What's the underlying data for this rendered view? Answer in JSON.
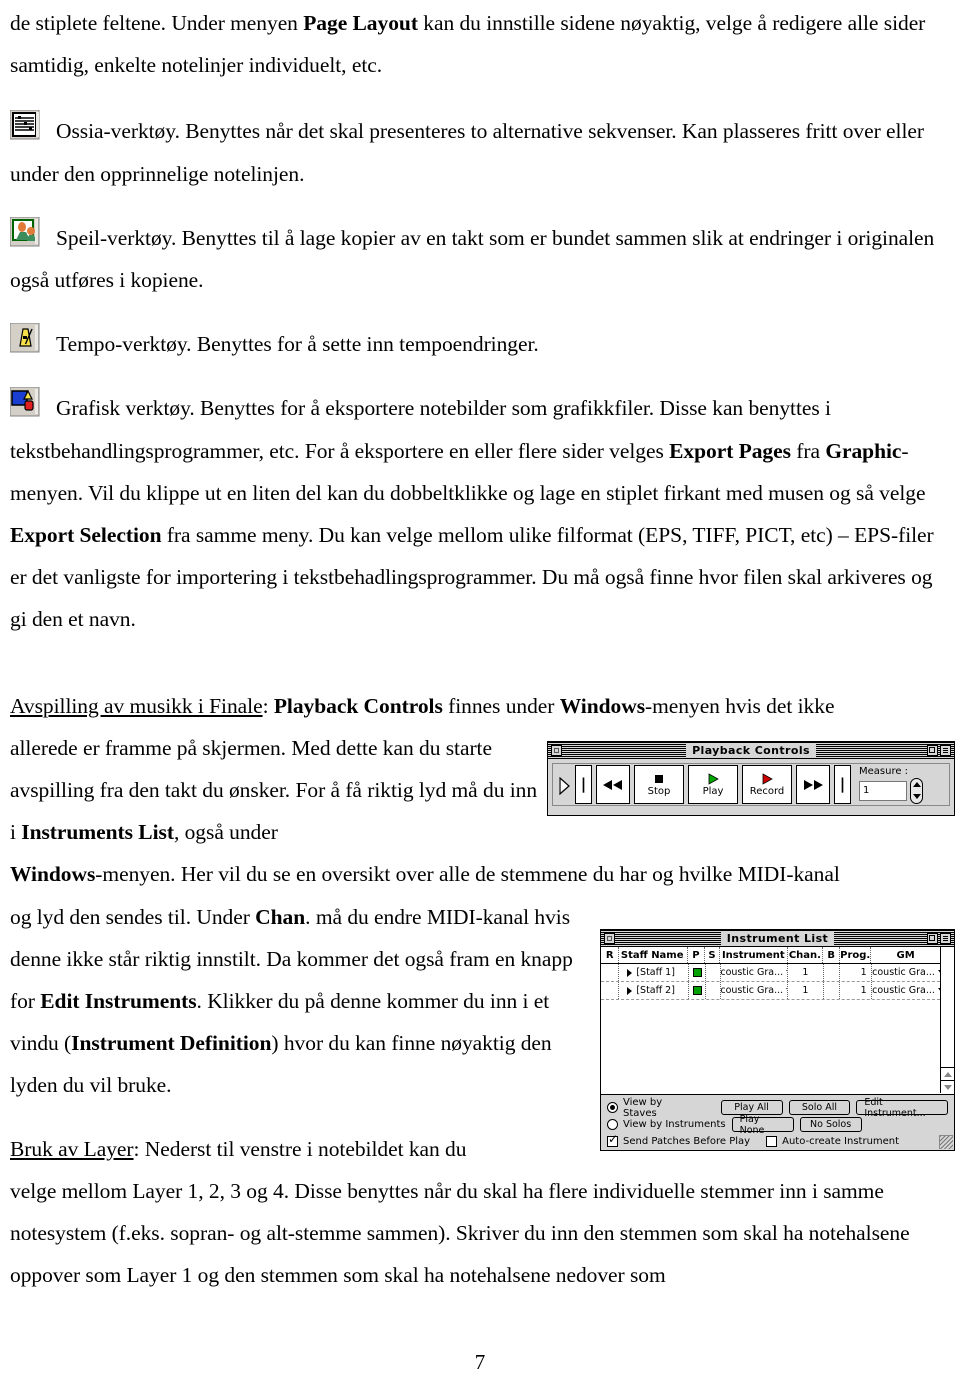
{
  "document": {
    "page_number": "7",
    "paragraphs": [
      {
        "id": "p1",
        "runs": [
          {
            "t": "de stiplete feltene. Under menyen ",
            "b": false
          },
          {
            "t": "Page Layout",
            "b": true
          },
          {
            "t": " kan du innstille sidene nøyaktig, velge å redigere alle sider samtidig, enkelte notelinjer individuelt, etc.",
            "b": false
          }
        ]
      },
      {
        "id": "p2",
        "icon": "ossia-tool-icon",
        "runs": [
          {
            "t": "Ossia-verktøy. Benyttes når det skal presenteres to alternative sekvenser. Kan plasseres fritt over eller under den opprinnelige notelinjen.",
            "b": false
          }
        ]
      },
      {
        "id": "p3",
        "icon": "mirror-tool-icon",
        "runs": [
          {
            "t": "Speil-verktøy. Benyttes til å lage kopier av en takt som er bundet sammen slik at endringer i originalen også utføres i kopiene.",
            "b": false
          }
        ]
      },
      {
        "id": "p4",
        "icon": "tempo-tool-icon",
        "runs": [
          {
            "t": "Tempo-verktøy. Benyttes for å sette inn tempoendringer.",
            "b": false
          }
        ]
      },
      {
        "id": "p5",
        "icon": "graphics-tool-icon",
        "runs": [
          {
            "t": "Grafisk verktøy. Benyttes for å eksportere notebilder som grafikkfiler. Disse kan benyttes i tekstbehandlingsprogrammer, etc. For å eksportere en eller flere sider velges ",
            "b": false
          },
          {
            "t": "Export Pages",
            "b": true
          },
          {
            "t": " fra ",
            "b": false
          },
          {
            "t": "Graphic",
            "b": true
          },
          {
            "t": "-menyen. Vil du klippe ut en liten del kan du dobbeltklikke og lage en stiplet firkant med musen og så velge ",
            "b": false
          },
          {
            "t": "Export Selection",
            "b": true
          },
          {
            "t": " fra samme meny. Du kan velge mellom ulike filformat (EPS, TIFF, PICT, etc) – EPS-filer er det vanligste for importering i tekstbehadlingsprogrammer. Du må også finne hvor filen skal arkiveres og gi den et navn.",
            "b": false
          }
        ]
      },
      {
        "id": "p6",
        "runs": [
          {
            "t": "Avspilling av musikk i Finale",
            "b": false,
            "u": true
          },
          {
            "t": ": ",
            "b": false
          },
          {
            "t": "Playback Controls",
            "b": true
          },
          {
            "t": " finnes under ",
            "b": false
          },
          {
            "t": "Windows",
            "b": true
          },
          {
            "t": "-menyen hvis det ikke allerede er framme på skjermen. Med dette kan du starte avspilling fra den takt du ønsker. For å få riktig lyd må du inn i ",
            "b": false
          },
          {
            "t": "Instruments List",
            "b": true
          },
          {
            "t": ", også under ",
            "b": false
          }
        ]
      },
      {
        "id": "p7",
        "runs": [
          {
            "t": "Windows",
            "b": true
          },
          {
            "t": "-menyen. Her vil du se en oversikt over alle de stemmene du har og hvilke MIDI-kanal og lyd den sendes til. Under ",
            "b": false
          },
          {
            "t": "Chan",
            "b": true
          },
          {
            "t": ". må du endre MIDI-kanal hvis denne ikke står riktig innstilt. Da kommer det også fram en knapp for ",
            "b": false
          },
          {
            "t": "Edit Instruments",
            "b": true
          },
          {
            "t": ". Klikker du på denne kommer du inn i et vindu (",
            "b": false
          },
          {
            "t": "Instrument Definition",
            "b": true
          },
          {
            "t": ") hvor du kan finne nøyaktig den lyden du vil bruke.",
            "b": false
          }
        ]
      },
      {
        "id": "p8",
        "runs": [
          {
            "t": "Bruk av Layer",
            "b": false,
            "u": true
          },
          {
            "t": ": Nederst til venstre i notebildet kan du velge mellom Layer 1, 2, 3 og 4. Disse benyttes når du skal ha flere individuelle stemmer inn i samme notesystem (f.eks. sopran- og alt-stemme sammen). Skriver du inn den stemmen som skal ha notehalsene oppover som Layer 1 og den stemmen som skal ha notehalsene nedover som",
            "b": false
          }
        ]
      }
    ]
  },
  "playback_controls": {
    "title": "Playback Controls",
    "buttons": [
      {
        "name": "playback-cursor",
        "glyph": "▷",
        "label": ""
      },
      {
        "name": "to-beginning",
        "glyph": "|",
        "label": ""
      },
      {
        "name": "rewind",
        "glyph": "◀◀",
        "label": ""
      },
      {
        "name": "stop",
        "glyph": "■",
        "label": "Stop"
      },
      {
        "name": "play",
        "glyph": "▶",
        "label": "Play"
      },
      {
        "name": "record",
        "glyph": "▶",
        "label": "Record"
      },
      {
        "name": "fast-forward",
        "glyph": "▶▶",
        "label": ""
      },
      {
        "name": "to-end",
        "glyph": "|",
        "label": ""
      }
    ],
    "measure_label": "Measure :",
    "measure_value": "1",
    "colors": {
      "play_green": "#00a800",
      "record_red": "#cc0000",
      "window_gray": "#d6d6d6"
    }
  },
  "instrument_list": {
    "title": "Instrument List",
    "columns": [
      "R",
      "Staff Name",
      "P",
      "S",
      "Instrument",
      "Chan.",
      "B",
      "Prog.",
      "GM"
    ],
    "rows": [
      {
        "staff": "[Staff 1]",
        "p": "on",
        "s": "",
        "instrument": "Acoustic Gra...",
        "chan": "1",
        "b": "",
        "prog": "1",
        "gm": "Acoustic Gra..."
      },
      {
        "staff": "[Staff 2]",
        "p": "on",
        "s": "",
        "instrument": "Acoustic Gra...",
        "chan": "1",
        "b": "",
        "prog": "1",
        "gm": "Acoustic Gra..."
      }
    ],
    "view_by_staves": "View by Staves",
    "view_by_instruments": "View by Instruments",
    "send_patches": "Send Patches Before Play",
    "auto_create": "Auto-create Instrument",
    "btn_play_all": "Play All",
    "btn_solo_all": "Solo All",
    "btn_edit_instrument": "Edit Instrument...",
    "btn_play_none": "Play None",
    "btn_no_solos": "No Solos"
  }
}
